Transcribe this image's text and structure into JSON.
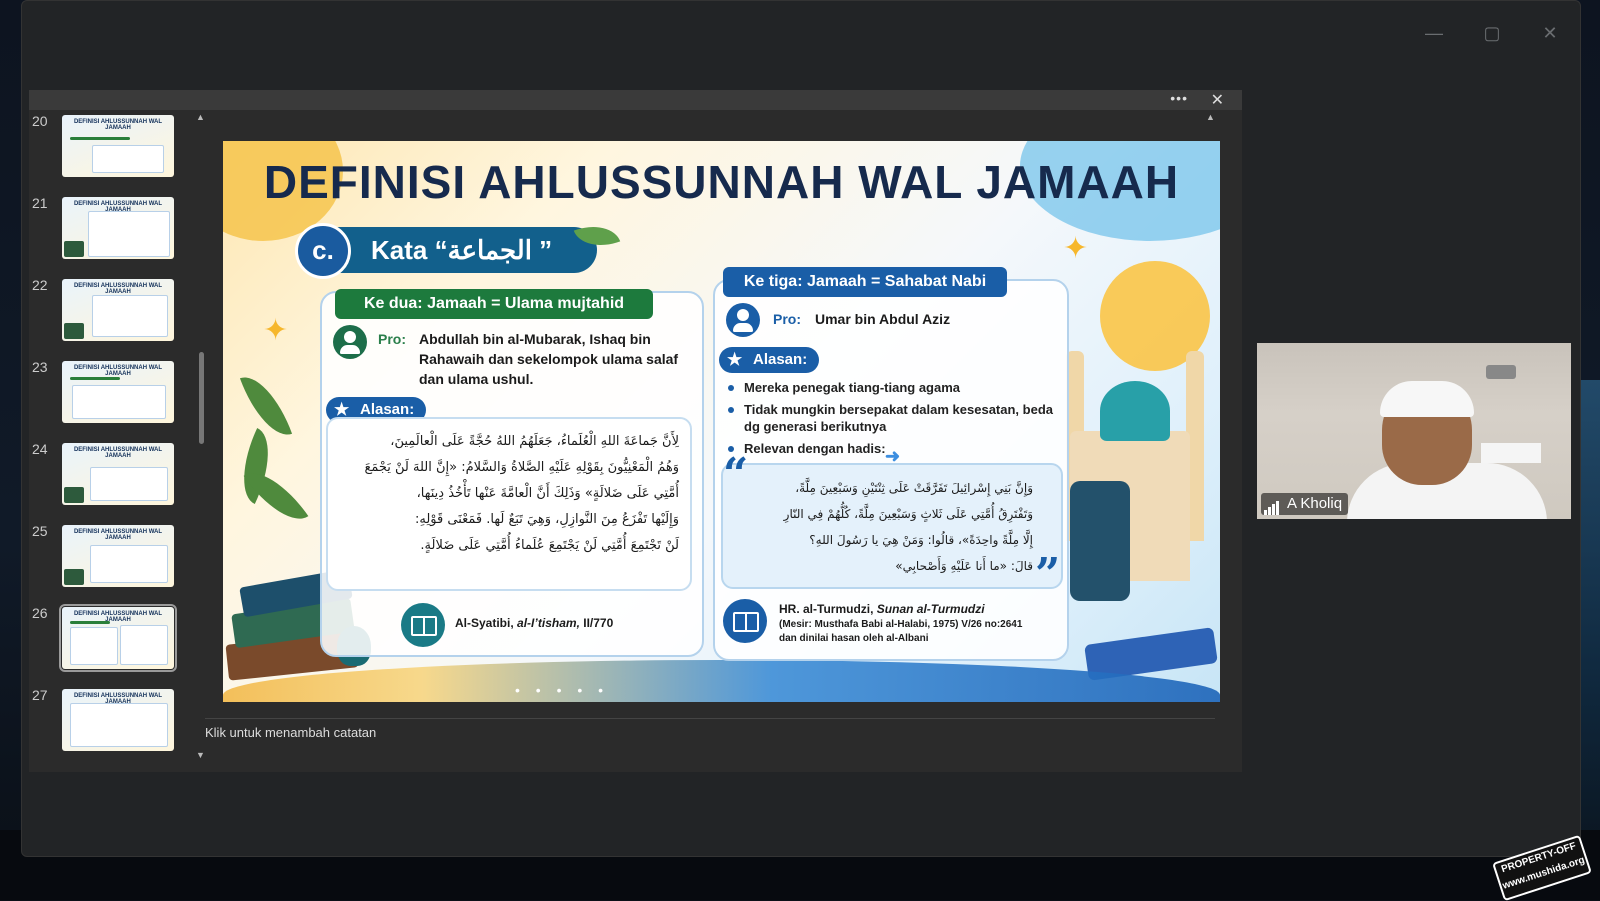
{
  "thumbnails": [
    {
      "number": "20",
      "title": "DEFINISI AHLUSSUNNAH WAL JAMAAH"
    },
    {
      "number": "21",
      "title": "DEFINISI AHLUSSUNNAH WAL JAMAAH"
    },
    {
      "number": "22",
      "title": "DEFINISI AHLUSSUNNAH WAL JAMAAH"
    },
    {
      "number": "23",
      "title": "DEFINISI AHLUSSUNNAH WAL JAMAAH"
    },
    {
      "number": "24",
      "title": "DEFINISI AHLUSSUNNAH WAL JAMAAH"
    },
    {
      "number": "25",
      "title": "DEFINISI AHLUSSUNNAH WAL JAMAAH"
    },
    {
      "number": "26",
      "title": "DEFINISI AHLUSSUNNAH WAL JAMAAH"
    },
    {
      "number": "27",
      "title": "DEFINISI AHLUSSUNNAH WAL JAMAAH"
    }
  ],
  "selected_thumbnail": "26",
  "share_toolbar": {
    "more_label": "•••",
    "close_label": "✕"
  },
  "window_controls": {
    "minimize": "—",
    "maximize": "▢",
    "close": "✕"
  },
  "slide": {
    "title": "DEFINISI AHLUSSUNNAH WAL JAMAAH",
    "section_letter": "c.",
    "section_label": "Kata “الجماعة ”",
    "left": {
      "header": "Ke dua: Jamaah = Ulama mujtahid",
      "pro_label": "Pro:",
      "pro_text": "Abdullah bin al-Mubarak, Ishaq bin Rahawaih dan sekelompok ulama salaf dan ulama ushul.",
      "alasan_label": "Alasan:",
      "arabic_lines": [
        "لِأَنَّ جَماعَةَ اللهِ الْعُلَماءُ، جَعَلَهُمُ اللهُ حُجَّةً عَلَى الْعالَمِينَ،",
        "وَهُمُ الْمَعْنِيُّونَ بِقَوْلِهِ عَلَيْهِ الصَّلاةُ وَالسَّلامُ: «إِنَّ اللهَ لَنْ يَجْمَعَ",
        "أُمَّتِي عَلَى ضَلالَةٍ» وَذَلِكَ أَنَّ الْعامَّةَ عَنْها تَأْخُذُ دِينَها،",
        "وَإِلَيْها تَفْزَعُ مِنَ النَّوازِلِ، وَهِيَ تَبَعٌ لَها. فَمَعْنَى قَوْلِهِ:",
        "لَنْ تَجْتَمِعَ أُمَّتِي لَنْ يَجْتَمِعَ عُلَماءُ أُمَّتِي عَلَى ضَلالَةٍ."
      ],
      "reference": "Al-Syatibi, ",
      "reference_italic": "al-I’tisham,",
      "reference_tail": " II/770"
    },
    "right": {
      "header": "Ke tiga: Jamaah = Sahabat Nabi",
      "pro_label": "Pro:",
      "pro_text": "Umar bin Abdul Aziz",
      "alasan_label": "Alasan:",
      "bullets": [
        "Mereka penegak tiang-tiang agama",
        "Tidak mungkin bersepakat dalam kesesatan, beda dg generasi berikutnya",
        "Relevan dengan hadis:"
      ],
      "arabic_lines": [
        "وَإِنَّ بَنِي إِسْرائِيلَ تَفَرَّقَتْ عَلَى ثِنْتَيْنِ وَسَبْعِينَ مِلَّةً،",
        "وَتَفْتَرِقُ أُمَّتِي عَلَى ثَلاثٍ وَسَبْعِينَ مِلَّةً، كُلُّهُمْ فِي النّارِ",
        "إِلَّا مِلَّةً واحِدَةً»، قالُوا: وَمَنْ هِيَ يا رَسُولَ اللهِ؟",
        "قالَ: «ما أَنا عَلَيْهِ وَأَصْحابِي»"
      ],
      "reference_line1": "HR. al-Turmudzi, ",
      "reference_line1_italic": "Sunan al-Turmudzi",
      "reference_line2": "(Mesir: Musthafa Babi al-Halabi, 1975) V/26 no:2641",
      "reference_line3": "dan dinilai hasan oleh al-Albani"
    },
    "bottom_dots": "• • • • •"
  },
  "notes_placeholder": "Klik untuk menambah catatan",
  "participant": {
    "name": "A Kholiq"
  },
  "watermark": {
    "line1": "PROPERTY-OFF",
    "line2": "www.mushida.org"
  },
  "colors": {
    "accent_green": "#1d7a3d",
    "accent_blue": "#1a5ea7",
    "title": "#162a4d"
  }
}
